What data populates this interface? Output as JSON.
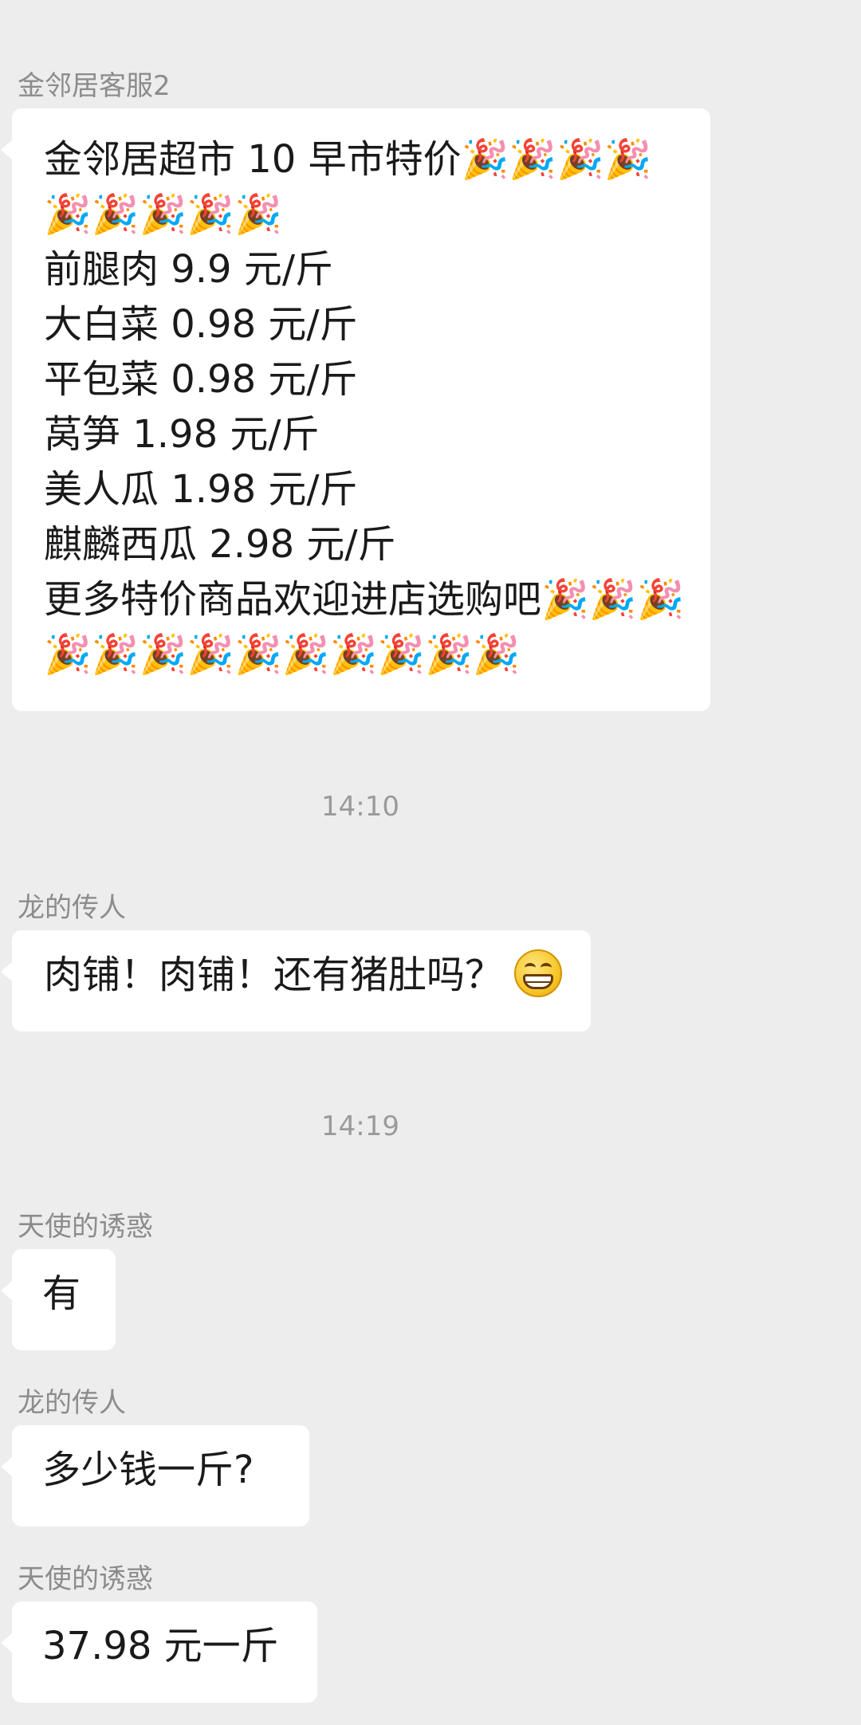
{
  "messages": [
    {
      "sender": "金邻居客服2",
      "text": "金邻居超市 10 早市特价🎉🎉🎉🎉🎉🎉🎉🎉🎉\n前腿肉 9.9 元/斤\n大白菜 0.98 元/斤\n平包菜 0.98 元/斤\n莴笋 1.98 元/斤\n美人瓜 1.98 元/斤\n麒麟西瓜 2.98 元/斤\n更多特价商品欢迎进店选购吧🎉🎉🎉🎉🎉🎉🎉🎉🎉🎉🎉🎉🎉"
    },
    {
      "time": "14:10"
    },
    {
      "sender": "龙的传人",
      "text": "肉铺！肉铺！还有猪肚吗？",
      "emoji": "grinning-face-icon"
    },
    {
      "time": "14:19"
    },
    {
      "sender": "天使的诱惑",
      "text": "有"
    },
    {
      "sender": "龙的传人",
      "text": "多少钱一斤?"
    },
    {
      "sender": "天使的诱惑",
      "text": "37.98 元一斤"
    }
  ]
}
